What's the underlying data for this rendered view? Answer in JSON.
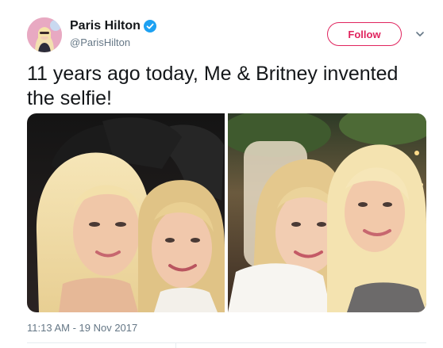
{
  "author": {
    "name": "Paris Hilton",
    "handle": "@ParisHilton",
    "verified_icon": "verified-badge-icon",
    "verified_color": "#1da1f2"
  },
  "actions": {
    "follow_label": "Follow",
    "follow_color": "#e0245e",
    "menu_icon": "chevron-down-icon"
  },
  "tweet": {
    "text": "11 years ago today, Me & Britney invented the selfie!",
    "timestamp": "11:13 AM - 19 Nov 2017"
  },
  "media": {
    "photos": [
      "photo-1",
      "photo-2"
    ]
  }
}
